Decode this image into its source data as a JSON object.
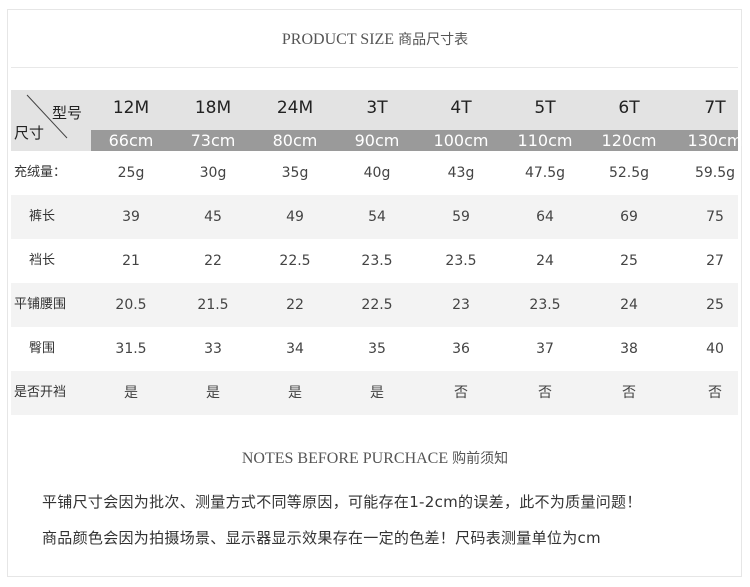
{
  "title": {
    "en": "PRODUCT SIZE",
    "cn": "商品尺寸表"
  },
  "table": {
    "corner": {
      "type_label": "型号",
      "size_label": "尺寸"
    },
    "sizes": [
      "12M",
      "18M",
      "24M",
      "3T",
      "4T",
      "5T",
      "6T",
      "7T"
    ],
    "heights": [
      "66cm",
      "73cm",
      "80cm",
      "90cm",
      "100cm",
      "110cm",
      "120cm",
      "130cm"
    ],
    "rows": [
      {
        "label": "充绒量：",
        "values": [
          "25g",
          "30g",
          "35g",
          "40g",
          "43g",
          "47.5g",
          "52.5g",
          "59.5g"
        ]
      },
      {
        "label": "裤长",
        "values": [
          "39",
          "45",
          "49",
          "54",
          "59",
          "64",
          "69",
          "75"
        ]
      },
      {
        "label": "裆长",
        "values": [
          "21",
          "22",
          "22.5",
          "23.5",
          "23.5",
          "24",
          "25",
          "27"
        ]
      },
      {
        "label": "平铺腰围",
        "values": [
          "20.5",
          "21.5",
          "22",
          "22.5",
          "23",
          "23.5",
          "24",
          "25"
        ]
      },
      {
        "label": "臀围",
        "values": [
          "31.5",
          "33",
          "34",
          "35",
          "36",
          "37",
          "38",
          "40"
        ]
      },
      {
        "label": "是否开裆",
        "values": [
          "是",
          "是",
          "是",
          "是",
          "否",
          "否",
          "否",
          "否"
        ]
      }
    ]
  },
  "notes": {
    "title_en": "NOTES BEFORE PURCHACE",
    "title_cn": "购前须知",
    "lines": [
      "平铺尺寸会因为批次、测量方式不同等原因，可能存在1-2cm的误差，此不为质量问题！",
      "商品颜色会因为拍摄场景、显示器显示效果存在一定的色差！尺码表测量单位为cm"
    ]
  },
  "colors": {
    "header_bg": "#e3e3e3",
    "height_bar": "#9a9a9a",
    "row_shade": "#f3f3f3"
  }
}
